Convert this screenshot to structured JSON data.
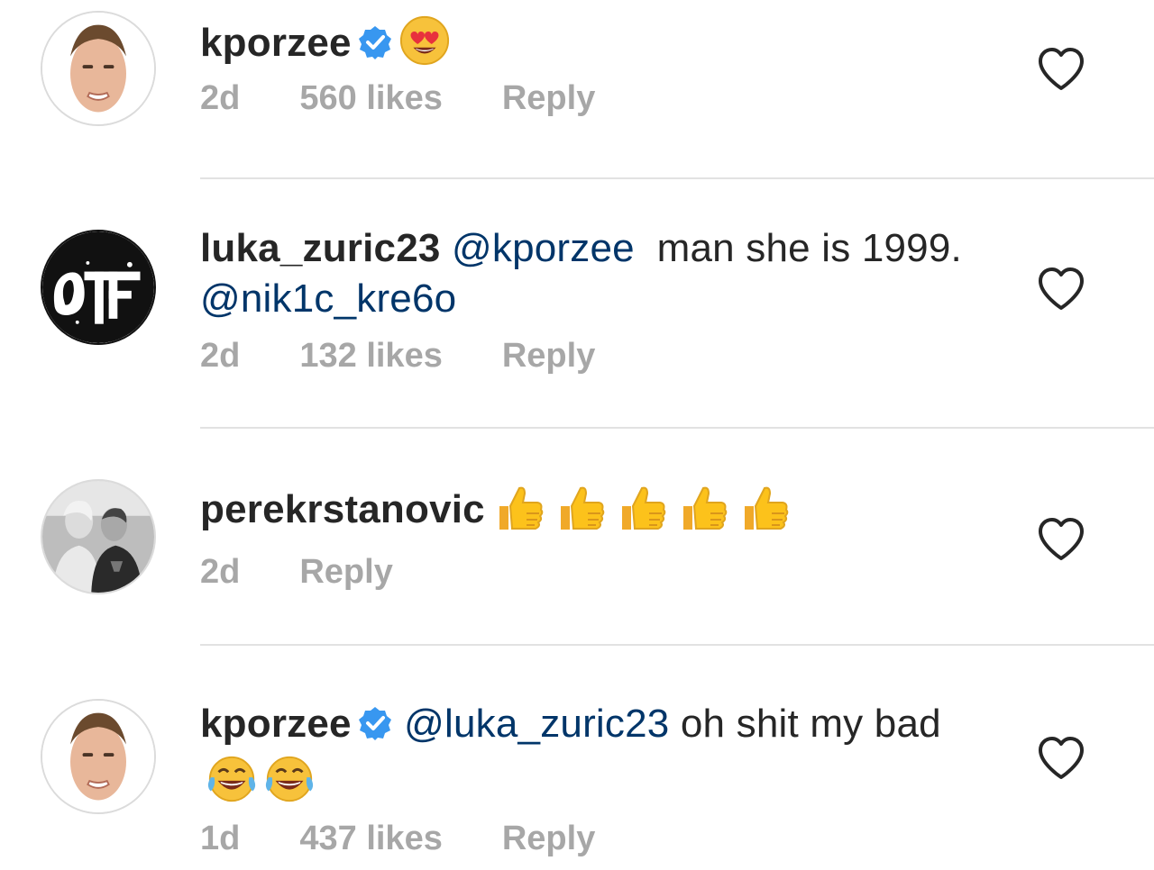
{
  "comments": [
    {
      "username": "kporzee",
      "verified": true,
      "text_before": "",
      "mention": "",
      "text": "",
      "emojis": [
        "heart-eyes-emoji"
      ],
      "time": "2d",
      "likes": "560 likes",
      "reply": "Reply"
    },
    {
      "username": "luka_zuric23",
      "verified": false,
      "mention": "@kporzee",
      "text": "  man she is 1999.",
      "mention2": "@nik1c_kre6o",
      "time": "2d",
      "likes": "132 likes",
      "reply": "Reply"
    },
    {
      "username": "perekrstanovic",
      "verified": false,
      "emojis": [
        "thumbs-up-emoji",
        "thumbs-up-emoji",
        "thumbs-up-emoji",
        "thumbs-up-emoji",
        "thumbs-up-emoji"
      ],
      "time": "2d",
      "reply": "Reply"
    },
    {
      "username": "kporzee",
      "verified": true,
      "mention": "@luka_zuric23",
      "text": " oh shit my bad",
      "emojis": [
        "tears-of-joy-emoji",
        "tears-of-joy-emoji"
      ],
      "time": "1d",
      "likes": "437 likes",
      "reply": "Reply"
    }
  ],
  "colors": {
    "text": "#262626",
    "mention": "#003569",
    "meta": "#a7a7a7",
    "verified": "#3897f0",
    "divider": "#e2e2e2"
  },
  "icons": {
    "like": "heart-outline-icon",
    "verified": "verified-badge-icon"
  }
}
